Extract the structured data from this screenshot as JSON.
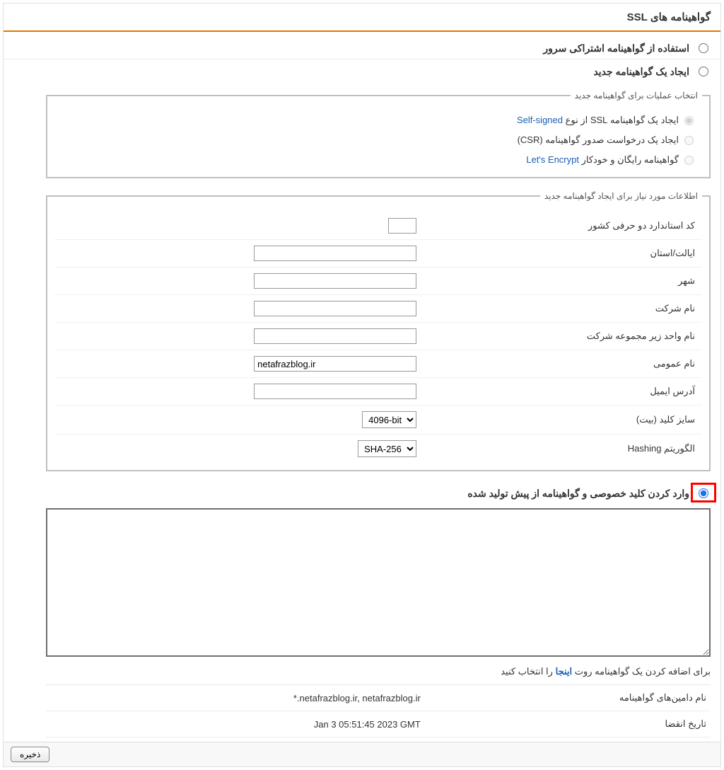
{
  "panel": {
    "title": "گواهینامه های SSL"
  },
  "options": {
    "shared": {
      "label": "استفاده از گواهینامه اشتراکی سرور"
    },
    "create": {
      "label": "ایجاد یک گواهینامه جدید",
      "action_fieldset": "انتخاب عملیات برای گواهینامه جدید",
      "actions": {
        "self_signed_pre": "ایجاد یک گواهینامه SSL از نوع",
        "self_signed_term": "Self-signed",
        "csr": "ایجاد یک درخواست صدور گواهینامه (CSR)",
        "lets_encrypt_pre": "گواهینامه رایگان و خودکار",
        "lets_encrypt_link": "Let's Encrypt"
      },
      "info_fieldset": "اطلاعات مورد نیاز برای ایجاد گواهینامه جدید",
      "fields": {
        "country": "کد استاندارد دو حرفی کشور",
        "province": "ایالت/استان",
        "city": "شهر",
        "company": "نام شرکت",
        "org_unit": "نام واحد زیر مجموعه شرکت",
        "common_name": "نام عمومی",
        "common_name_value": "netafrazblog.ir",
        "email": "آدرس ایمیل",
        "key_size": "سایز کلید (بیت)",
        "key_size_value": "4096-bit",
        "hashing": "الگوریتم Hashing",
        "hashing_value": "SHA-256"
      }
    },
    "paste": {
      "label": "وارد کردن کلید خصوصی و گواهینامه از پیش تولید شده"
    }
  },
  "root_cert_line_pre": "برای اضافه کردن یک گواهینامه روت",
  "root_cert_link": "اینجا",
  "root_cert_line_post": "را انتخاب کنید",
  "meta": {
    "domains_label": "نام دامین‌های گواهینامه",
    "domains_value": "*.netafrazblog.ir, netafrazblog.ir",
    "expiry_label": "تاریخ انقضا",
    "expiry_value": "Jan 3 05:51:45 2023 GMT"
  },
  "footer": {
    "save": "ذخیره"
  }
}
